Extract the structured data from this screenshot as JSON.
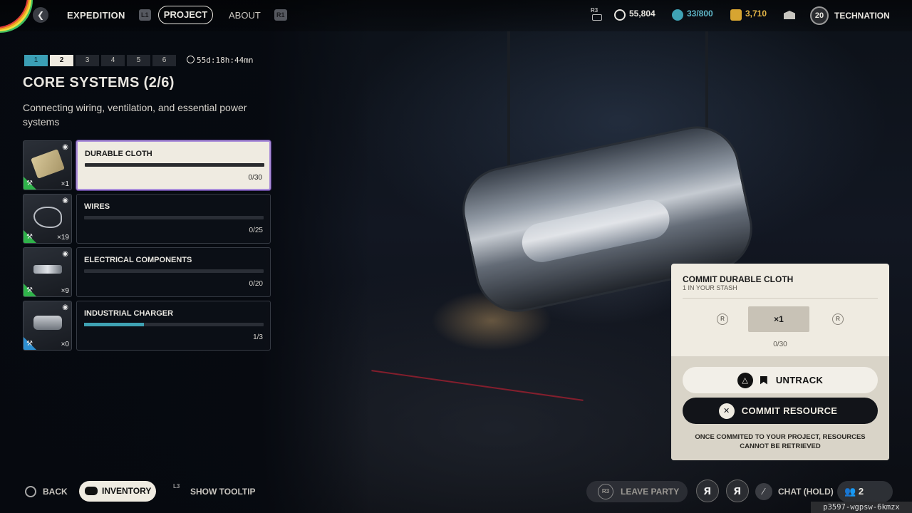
{
  "nav": {
    "back_icon": "chevron-left-icon",
    "expedition": "EXPEDITION",
    "l1_key": "L1",
    "project": "PROJECT",
    "about": "ABOUT",
    "r1_key": "R1"
  },
  "currencies": {
    "r3_key": "R3",
    "coins": "55,804",
    "stash": "33/800",
    "tokens": "3,710",
    "level": "20",
    "username": "TECHNATION"
  },
  "project": {
    "steps": [
      "1",
      "2",
      "3",
      "4",
      "5",
      "6"
    ],
    "current_step": 2,
    "timer": "55d:18h:44mn",
    "title": "CORE SYSTEMS (2/6)",
    "description": "Connecting wiring, ventilation, and essential power systems"
  },
  "resources": [
    {
      "name": "DURABLE CLOTH",
      "qty": "×1",
      "count": "0/30",
      "progress": 0,
      "corner": "green",
      "icon": "cloth-icon"
    },
    {
      "name": "WIRES",
      "qty": "×19",
      "count": "0/25",
      "progress": 0,
      "corner": "green",
      "icon": "wires-icon"
    },
    {
      "name": "ELECTRICAL COMPONENTS",
      "qty": "×9",
      "count": "0/20",
      "progress": 0,
      "corner": "green",
      "icon": "electrical-components-icon"
    },
    {
      "name": "INDUSTRIAL CHARGER",
      "qty": "×0",
      "count": "1/3",
      "progress": 0.333,
      "corner": "blue",
      "icon": "charger-icon"
    }
  ],
  "commit": {
    "title": "COMMIT DURABLE CLOTH",
    "subtitle": "1 IN YOUR STASH",
    "left_key": "R",
    "right_key": "R",
    "quantity": "×1",
    "count": "0/30",
    "untrack_label": "UNTRACK",
    "commit_label": "COMMIT RESOURCE",
    "warning_line1": "ONCE COMMITED TO YOUR PROJECT, RESOURCES",
    "warning_line2": "CANNOT BE RETRIEVED"
  },
  "bottom": {
    "back": "BACK",
    "inventory": "INVENTORY",
    "l3_key": "L3",
    "tooltip": "SHOW TOOLTIP",
    "leave_r3": "R3",
    "leave_party": "LEAVE PARTY",
    "chat": "CHAT (HOLD)",
    "party_count": "2",
    "session_id": "p3597-wgpsw-6kmzx"
  },
  "colors": {
    "accent_teal": "#3fa2b4",
    "panel_cream": "#efebe1",
    "corner_green": "#2fb34a",
    "corner_blue": "#2d8fd0",
    "active_outline": "#a98cd8"
  }
}
